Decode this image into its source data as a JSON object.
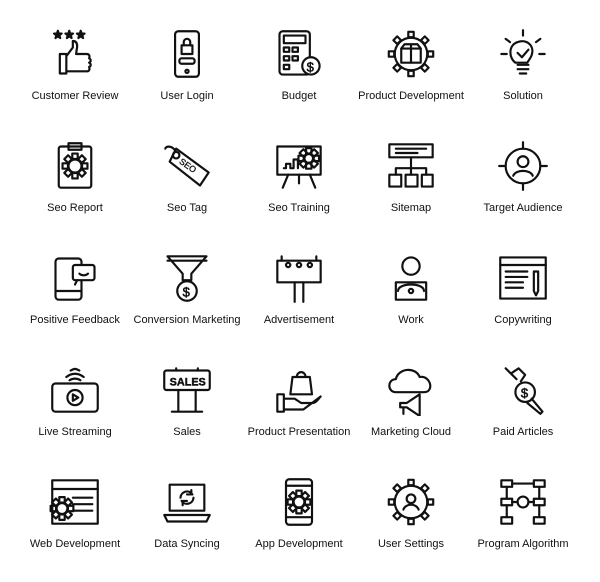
{
  "stroke_color": "#111111",
  "items": [
    {
      "label": "Customer Review",
      "icon": "thumbs-up-stars-icon"
    },
    {
      "label": "User Login",
      "icon": "phone-lock-icon"
    },
    {
      "label": "Budget",
      "icon": "calculator-dollar-icon"
    },
    {
      "label": "Product Development",
      "icon": "gear-box-icon"
    },
    {
      "label": "Solution",
      "icon": "lightbulb-check-icon"
    },
    {
      "label": "Seo Report",
      "icon": "clipboard-gear-icon"
    },
    {
      "label": "Seo Tag",
      "icon": "price-tag-icon",
      "tag_text": "SEO"
    },
    {
      "label": "Seo Training",
      "icon": "presentation-board-icon"
    },
    {
      "label": "Sitemap",
      "icon": "sitemap-icon"
    },
    {
      "label": "Target Audience",
      "icon": "target-user-icon"
    },
    {
      "label": "Positive Feedback",
      "icon": "phone-smile-chat-icon"
    },
    {
      "label": "Conversion Marketing",
      "icon": "funnel-dollar-icon"
    },
    {
      "label": "Advertisement",
      "icon": "billboard-icon"
    },
    {
      "label": "Work",
      "icon": "person-laptop-icon"
    },
    {
      "label": "Copywriting",
      "icon": "browser-pencil-icon"
    },
    {
      "label": "Live Streaming",
      "icon": "phone-play-wifi-icon"
    },
    {
      "label": "Sales",
      "icon": "sales-sign-icon",
      "sign_text": "SALES"
    },
    {
      "label": "Product Presentation",
      "icon": "hand-bag-icon"
    },
    {
      "label": "Marketing Cloud",
      "icon": "cloud-megaphone-icon"
    },
    {
      "label": "Paid Articles",
      "icon": "pen-dollar-icon"
    },
    {
      "label": "Web Development",
      "icon": "browser-gear-icon"
    },
    {
      "label": "Data Syncing",
      "icon": "laptop-sync-icon"
    },
    {
      "label": "App Development",
      "icon": "phone-gear-icon"
    },
    {
      "label": "User Settings",
      "icon": "gear-user-icon"
    },
    {
      "label": "Program Algorithm",
      "icon": "algorithm-icon"
    }
  ]
}
